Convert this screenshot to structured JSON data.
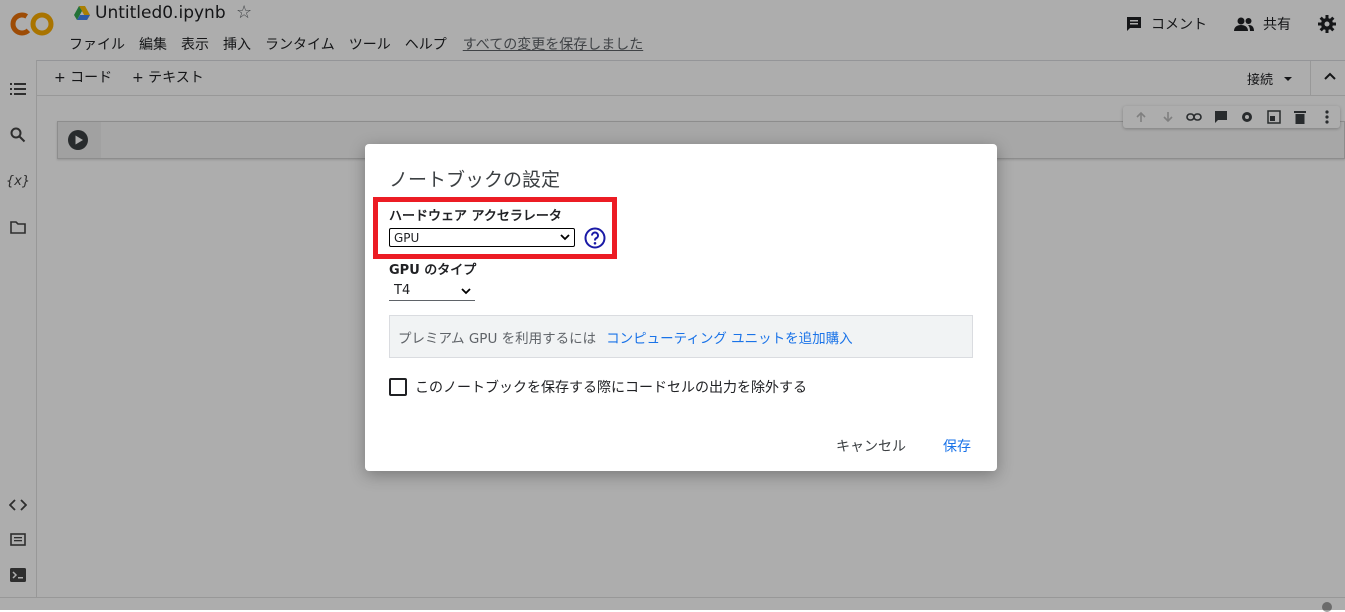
{
  "app": {
    "logo_text": "CO",
    "title": "Untitled0.ipynb"
  },
  "menu": [
    "ファイル",
    "編集",
    "表示",
    "挿入",
    "ランタイム",
    "ツール",
    "ヘルプ"
  ],
  "save_status": "すべての変更を保存しました",
  "header_right": {
    "comment_label": "コメント",
    "share_label": "共有"
  },
  "toolbar": {
    "add_code_label": "+ コード",
    "add_text_label": "+ テキスト",
    "connect_label": "接続"
  },
  "left_rail": {
    "variables_icon_text": "{x}"
  },
  "dialog": {
    "title": "ノートブックの設定",
    "hw_label": "ハードウェア アクセラレータ",
    "hw_value": "GPU",
    "gpu_type_label": "GPU のタイプ",
    "gpu_type_value": "T4",
    "info_text": "プレミアム GPU を利用するには",
    "info_link": "コンピューティング ユニットを追加購入",
    "checkbox_label": "このノートブックを保存する際にコードセルの出力を除外する",
    "checkbox_checked": false,
    "cancel_label": "キャンセル",
    "save_label": "保存"
  },
  "colors": {
    "highlight": "#ec1c24",
    "link": "#1a73e8",
    "logo_orange": "#f9ab00",
    "logo_dark_orange": "#e8710a"
  }
}
